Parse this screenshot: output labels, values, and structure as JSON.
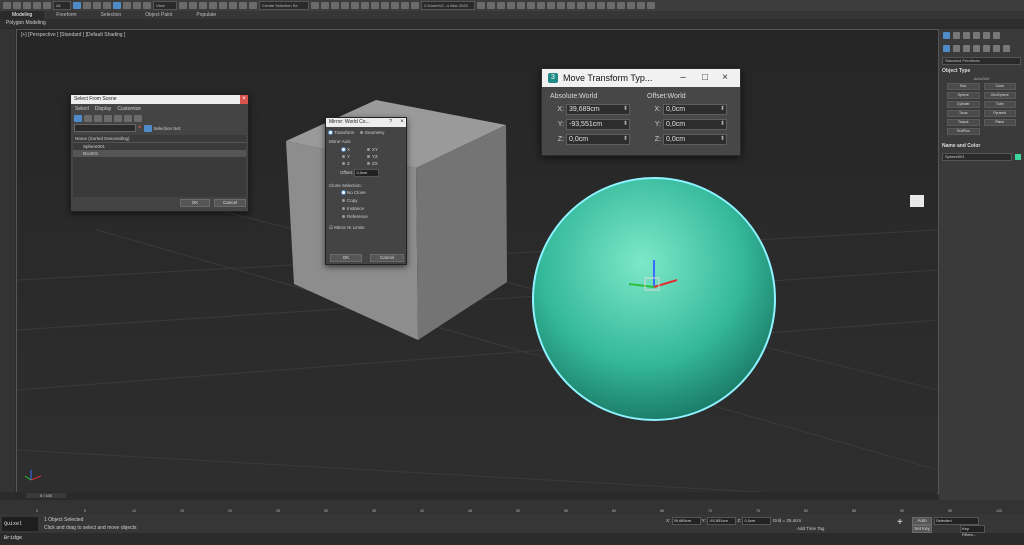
{
  "toolbar": {
    "view_dropdown": "View",
    "selection_set": "Create Selection Se",
    "workspace": "C:\\Users\\G...s Max 2020"
  },
  "ribbon": {
    "tabs": [
      "Modeling",
      "Freeform",
      "Selection",
      "Object Paint",
      "Populate"
    ],
    "sub_label": "Polygon Modeling"
  },
  "viewport": {
    "label": "[+] [Perspective ] [Standard ] [Default Shading ]"
  },
  "select_from_scene": {
    "title": "Select From Scene",
    "menu": [
      "Select",
      "Display",
      "Customize"
    ],
    "selection_set_label": "Selection Set:",
    "column_header": "Name (Sorted Descending)",
    "items": [
      "Sphere001",
      "Box001"
    ],
    "ok": "OK",
    "cancel": "Cancel"
  },
  "mirror": {
    "title": "Mirror: World Co...",
    "help": "?",
    "mode_transform": "Transform",
    "mode_geometry": "Geometry",
    "axis_heading": "Mirror Axis:",
    "axes": [
      "X",
      "Y",
      "Z",
      "XY",
      "YZ",
      "ZX"
    ],
    "offset_label": "Offset:",
    "offset_value": "0,0cm",
    "clone_heading": "Clone Selection:",
    "clone_options": [
      "No Clone",
      "Copy",
      "Instance",
      "Reference"
    ],
    "ik_label": "Mirror IK Limits",
    "ok": "OK",
    "cancel": "Cancel"
  },
  "move_transform": {
    "logo": "3",
    "title": "Move Transform Typ...",
    "absolute_heading": "Absolute:World",
    "offset_heading": "Offset:World",
    "absolute": [
      {
        "axis": "X:",
        "value": "39,689cm"
      },
      {
        "axis": "Y:",
        "value": "-93,551cm"
      },
      {
        "axis": "Z:",
        "value": "0,0cm"
      }
    ],
    "offset": [
      {
        "axis": "X:",
        "value": "0,0cm"
      },
      {
        "axis": "Y:",
        "value": "0,0cm"
      },
      {
        "axis": "Z:",
        "value": "0,0cm"
      }
    ]
  },
  "command_panel": {
    "dropdown": "Standard Primitives",
    "object_type_heading": "Object Type",
    "autogrid": "AutoGrid",
    "buttons": [
      "Box",
      "Cone",
      "Sphere",
      "GeoSphere",
      "Cylinder",
      "Tube",
      "Torus",
      "Pyramid",
      "Teapot",
      "Plane",
      "TextPlus"
    ],
    "name_color_heading": "Name and Color",
    "object_name": "Sphere001",
    "object_color": "#3fd39e"
  },
  "timeline": {
    "frame_label": "0 / 100",
    "ticks": [
      "0",
      "5",
      "10",
      "15",
      "20",
      "25",
      "30",
      "35",
      "40",
      "45",
      "50",
      "55",
      "60",
      "65",
      "70",
      "75",
      "80",
      "85",
      "90",
      "95",
      "100"
    ]
  },
  "status": {
    "script_label": "Quixel Bridge",
    "selection_info": "1 Object Selected",
    "prompt": "Click and drag to select and move objects",
    "x_value": "39,689cm",
    "y_value": "-93,551cm",
    "z_value": "0,0cm",
    "grid": "Grid = 25,4cm",
    "add_time_tag": "Add Time Tag",
    "auto_key": "Auto Key",
    "set_key": "Set Key",
    "selected": "Selected",
    "key_filters": "Key Filters..."
  }
}
